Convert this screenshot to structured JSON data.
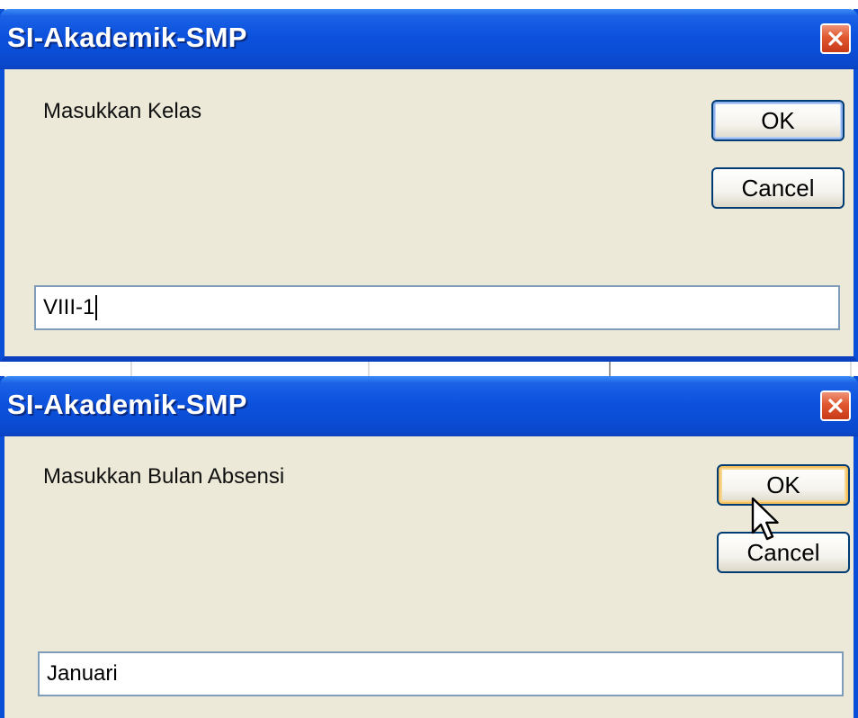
{
  "dialogs": [
    {
      "title": "SI-Akademik-SMP",
      "prompt": "Masukkan Kelas",
      "ok_label": "OK",
      "cancel_label": "Cancel",
      "input_value": "VIII-1"
    },
    {
      "title": "SI-Akademik-SMP",
      "prompt": "Masukkan Bulan Absensi",
      "ok_label": "OK",
      "cancel_label": "Cancel",
      "input_value": "Januari"
    }
  ],
  "colors": {
    "titlebar": "#0a4bd2",
    "dialog_bg": "#ece9d8",
    "close_button": "#e0582f"
  },
  "icons": {
    "close": "close-icon",
    "cursor": "mouse-pointer-icon"
  }
}
